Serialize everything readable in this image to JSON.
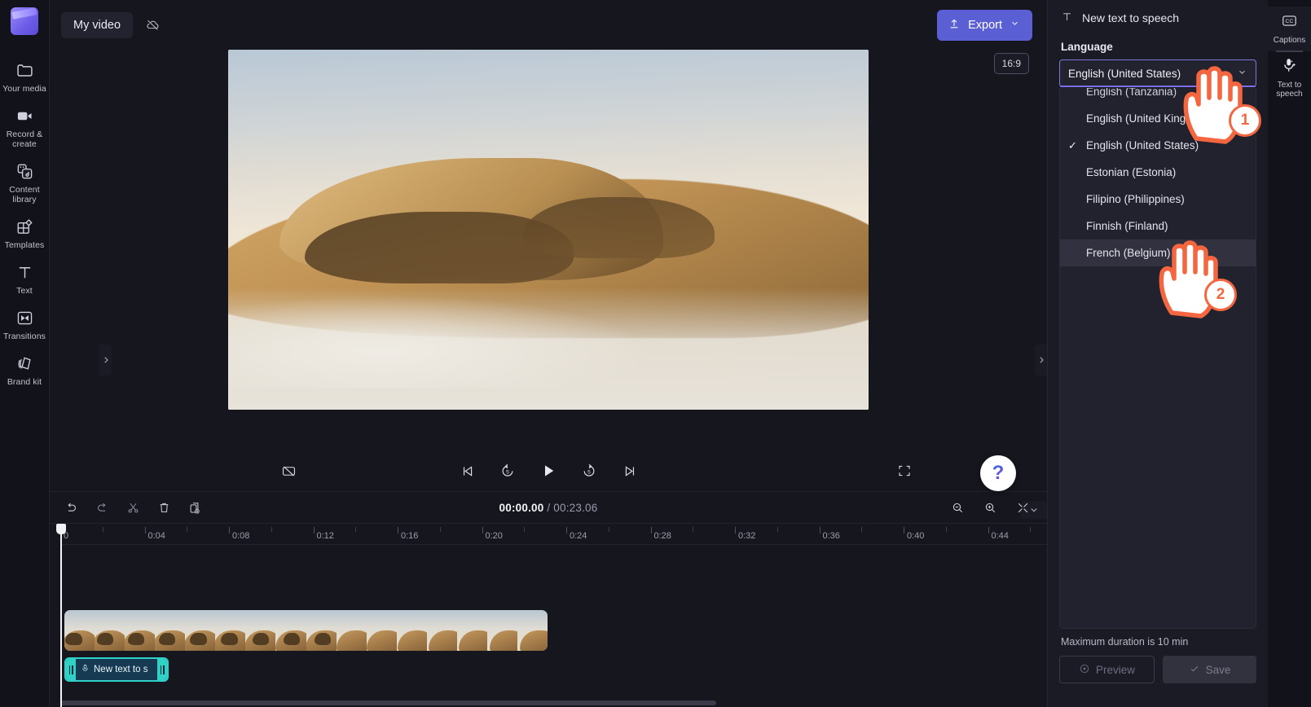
{
  "sidebar": {
    "logo_name": "clipchamp-logo",
    "items": [
      {
        "icon": "folder-icon",
        "label": "Your media"
      },
      {
        "icon": "video-camera-icon",
        "label": "Record &\ncreate"
      },
      {
        "icon": "library-icon",
        "label": "Content\nlibrary"
      },
      {
        "icon": "templates-icon",
        "label": "Templates"
      },
      {
        "icon": "text-icon",
        "label": "Text"
      },
      {
        "icon": "transitions-icon",
        "label": "Transitions"
      },
      {
        "icon": "brandkit-icon",
        "label": "Brand kit"
      }
    ]
  },
  "topbar": {
    "project_name": "My video",
    "cloud_icon": "cloud-off-icon",
    "export_label": "Export",
    "export_icon": "upload-arrow-icon",
    "export_chevron": "chevron-down-icon",
    "export_color": "#5b5fd4"
  },
  "stage": {
    "aspect_ratio": "16:9",
    "help_label": "?",
    "captions_toggle_icon": "captions-off-icon",
    "controls": [
      {
        "icon": "skip-previous-icon",
        "name": "skip-to-start-button"
      },
      {
        "icon": "rewind-5-icon",
        "name": "rewind-5-seconds-button"
      },
      {
        "icon": "play-icon",
        "name": "play-button"
      },
      {
        "icon": "forward-5-icon",
        "name": "forward-5-seconds-button"
      },
      {
        "icon": "skip-next-icon",
        "name": "skip-to-end-button"
      }
    ],
    "fullscreen_icon": "fullscreen-icon"
  },
  "timeline": {
    "tools": [
      {
        "icon": "undo-icon",
        "name": "undo-button"
      },
      {
        "icon": "redo-icon",
        "name": "redo-button"
      },
      {
        "icon": "scissors-icon",
        "name": "split-button"
      },
      {
        "icon": "trash-icon",
        "name": "delete-button"
      },
      {
        "icon": "duplicate-icon",
        "name": "duplicate-button"
      }
    ],
    "current_time": "00:00.00",
    "separator": "/",
    "total_time": "00:23.06",
    "zoom_tools": [
      {
        "icon": "zoom-out-icon",
        "name": "zoom-out-button"
      },
      {
        "icon": "zoom-in-icon",
        "name": "zoom-in-button"
      },
      {
        "icon": "fit-icon",
        "name": "fit-to-timeline-button"
      }
    ],
    "ruler_labels": [
      "0",
      "0:04",
      "0:08",
      "0:12",
      "0:16",
      "0:20",
      "0:24",
      "0:28",
      "0:32",
      "0:36",
      "0:40",
      "0:44"
    ],
    "audio_clip_label": "New text to s",
    "audio_clip_icon": "text-to-speech-icon"
  },
  "right_panel": {
    "header_title": "New text to speech",
    "header_icon": "text-icon",
    "section_label": "Language",
    "selected_language": "English (United States)",
    "select_chevron": "chevron-down-icon",
    "options": [
      {
        "label": "English (Tanzania)",
        "checked": false,
        "hovered": false,
        "clipped": true
      },
      {
        "label": "English (United Kingdom)",
        "checked": false,
        "hovered": false,
        "clipped": false
      },
      {
        "label": "English (United States)",
        "checked": true,
        "hovered": false,
        "clipped": false
      },
      {
        "label": "Estonian (Estonia)",
        "checked": false,
        "hovered": false,
        "clipped": false
      },
      {
        "label": "Filipino (Philippines)",
        "checked": false,
        "hovered": false,
        "clipped": false
      },
      {
        "label": "Finnish (Finland)",
        "checked": false,
        "hovered": false,
        "clipped": false
      },
      {
        "label": "French (Belgium)",
        "checked": false,
        "hovered": true,
        "clipped": false
      }
    ],
    "duration_note": "Maximum duration is 10 min",
    "preview_label": "Preview",
    "preview_icon": "play-circle-icon",
    "save_label": "Save",
    "save_icon": "check-icon"
  },
  "far_rail": {
    "items": [
      {
        "icon": "captions-icon",
        "label": "Captions",
        "active": true
      },
      {
        "icon": "text-to-speech-icon",
        "label": "Text to\nspeech",
        "active": false
      }
    ]
  },
  "annotations": {
    "step_one": "1",
    "step_two": "2",
    "accent_color": "#f4663f"
  }
}
